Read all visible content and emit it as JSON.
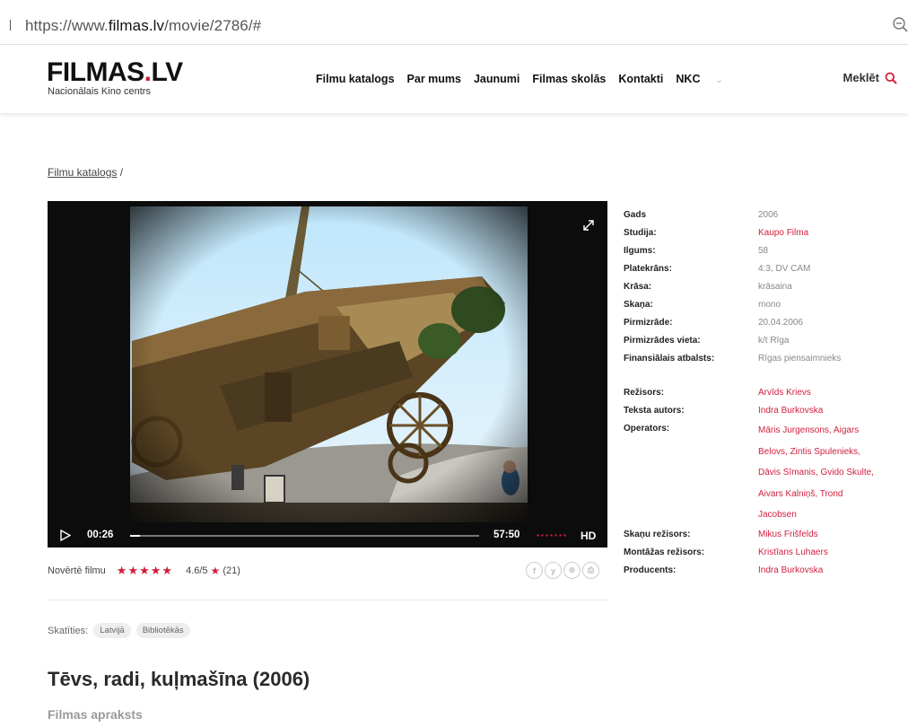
{
  "browser": {
    "url_prefix": "https://www.",
    "url_domain": "filmas.lv",
    "url_path": "/movie/2786/#"
  },
  "header": {
    "logo_main": "FILMAS",
    "logo_dot": ".",
    "logo_tld": "LV",
    "logo_sub": "Nacionālais Kino centrs",
    "nav": [
      "Filmu katalogs",
      "Par mums",
      "Jaunumi",
      "Filmas skolās",
      "Kontakti",
      "NKC"
    ],
    "search_label": "Meklēt"
  },
  "breadcrumb": {
    "link": "Filmu katalogs",
    "separator": "/"
  },
  "player": {
    "current_time": "00:26",
    "duration": "57:50",
    "quality": "HD",
    "progress": 0.027
  },
  "rating": {
    "label": "Novērtē filmu",
    "stars": "★★★★★",
    "score": "4.6/5",
    "star": "★",
    "count": "(21)"
  },
  "social": [
    "f",
    "y",
    "⊕",
    "⎙"
  ],
  "watch": {
    "label": "Skatīties:",
    "options": [
      "Latvijā",
      "Bibliotēkās"
    ]
  },
  "film": {
    "title": "Tēvs, radi, kuļmašīna (2006)",
    "description_heading": "Filmas apraksts"
  },
  "details": {
    "gads": {
      "k": "Gads",
      "v": "2006"
    },
    "studija": {
      "k": "Studija:",
      "v": "Kaupo Filma"
    },
    "ilgums": {
      "k": "Ilgums:",
      "v": "58"
    },
    "platekrans": {
      "k": "Platekrāns:",
      "v": "4:3, DV CAM"
    },
    "krasa": {
      "k": "Krāsa:",
      "v": "krāsaina"
    },
    "skana": {
      "k": "Skaņa:",
      "v": "mono"
    },
    "pirmizrade": {
      "k": "Pirmizrāde:",
      "v": "20.04.2006"
    },
    "pirmizrades_vieta": {
      "k": "Pirmizrādes vieta:",
      "v": "k/t Rīga"
    },
    "atbalsts": {
      "k": "Finansiālais atbalsts:",
      "v": "Rīgas piensaimnieks"
    },
    "rezisors": {
      "k": "Režisors:",
      "v": "Arvīds Krievs"
    },
    "teksta_autors": {
      "k": "Teksta autors:",
      "v": "Indra Burkovska"
    },
    "operators": {
      "k": "Operators:",
      "lines": [
        "Māris Jurgensons, Aigars",
        "Belovs, Zintis Spulenieks,",
        "Dāvis Sīmanis, Gvido Skulte,",
        "Aivars Kalniņš, Trond",
        "Jacobsen"
      ]
    },
    "skanu_rezisors": {
      "k": "Skaņu režisors:",
      "v": "Mikus Frišfelds"
    },
    "montazas_rezisors": {
      "k": "Montāžas režisors:",
      "v": "Kristīans Luhaers"
    },
    "producents": {
      "k": "Producents:",
      "v": "Indra Burkovska"
    }
  }
}
